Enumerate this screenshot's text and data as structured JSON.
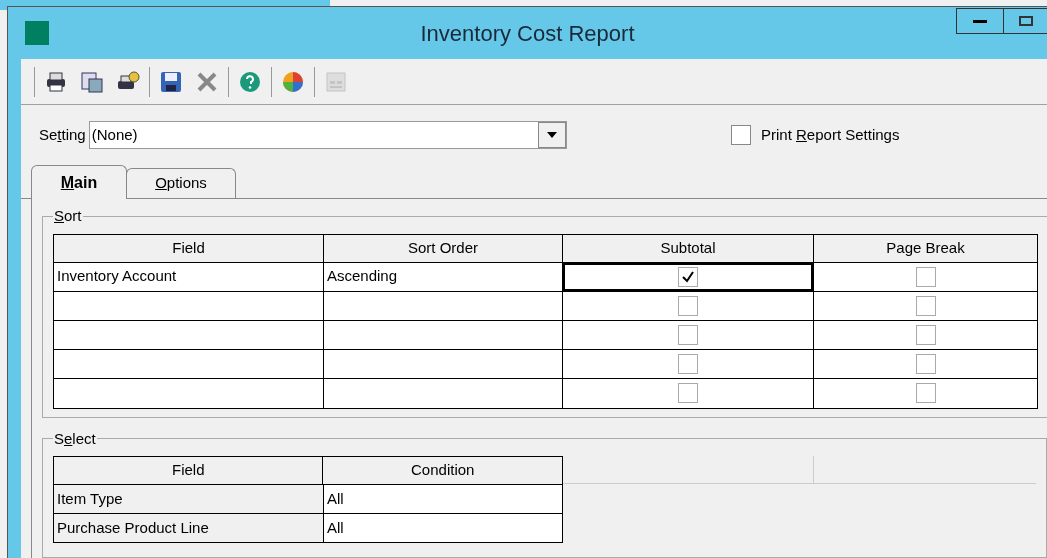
{
  "window": {
    "title": "Inventory Cost Report"
  },
  "toolbar": [
    {
      "kind": "print",
      "disabled": false
    },
    {
      "kind": "preview",
      "disabled": false
    },
    {
      "kind": "deferred",
      "disabled": false
    },
    {
      "kind": "save",
      "disabled": false
    },
    {
      "kind": "delete",
      "disabled": false
    },
    {
      "kind": "help",
      "disabled": false
    },
    {
      "kind": "chart",
      "disabled": false
    },
    {
      "kind": "designer",
      "disabled": true
    }
  ],
  "setting": {
    "label": {
      "before": "Se",
      "key": "t",
      "after": "ting"
    },
    "value": "(None)"
  },
  "print_report_settings": {
    "label": {
      "before": "Print ",
      "key": "R",
      "after": "eport Settings"
    },
    "checked": false
  },
  "tabs": [
    {
      "label": {
        "key": "M",
        "after": "ain"
      },
      "selected": true
    },
    {
      "label": {
        "key": "O",
        "after": "ptions"
      },
      "selected": false
    }
  ],
  "sort": {
    "title": {
      "key": "S",
      "after": "ort"
    },
    "columns": [
      "Field",
      "Sort Order",
      "Subtotal",
      "Page Break"
    ],
    "rows": [
      {
        "field": "Inventory Account",
        "sort_order": "Ascending",
        "subtotal": true,
        "page_break": false,
        "focused": true
      },
      {
        "subtotal": false,
        "page_break": false,
        "focused": false
      },
      {
        "subtotal": false,
        "page_break": false,
        "focused": false
      },
      {
        "subtotal": false,
        "page_break": false,
        "focused": false
      },
      {
        "subtotal": false,
        "page_break": false,
        "focused": false
      }
    ]
  },
  "select": {
    "title": {
      "before": "S",
      "key": "e",
      "after": "lect"
    },
    "columns": [
      "Field",
      "Condition"
    ],
    "rows": [
      {
        "field": "Item Type",
        "condition": "All"
      },
      {
        "field": "Purchase Product Line",
        "condition": "All"
      }
    ]
  }
}
